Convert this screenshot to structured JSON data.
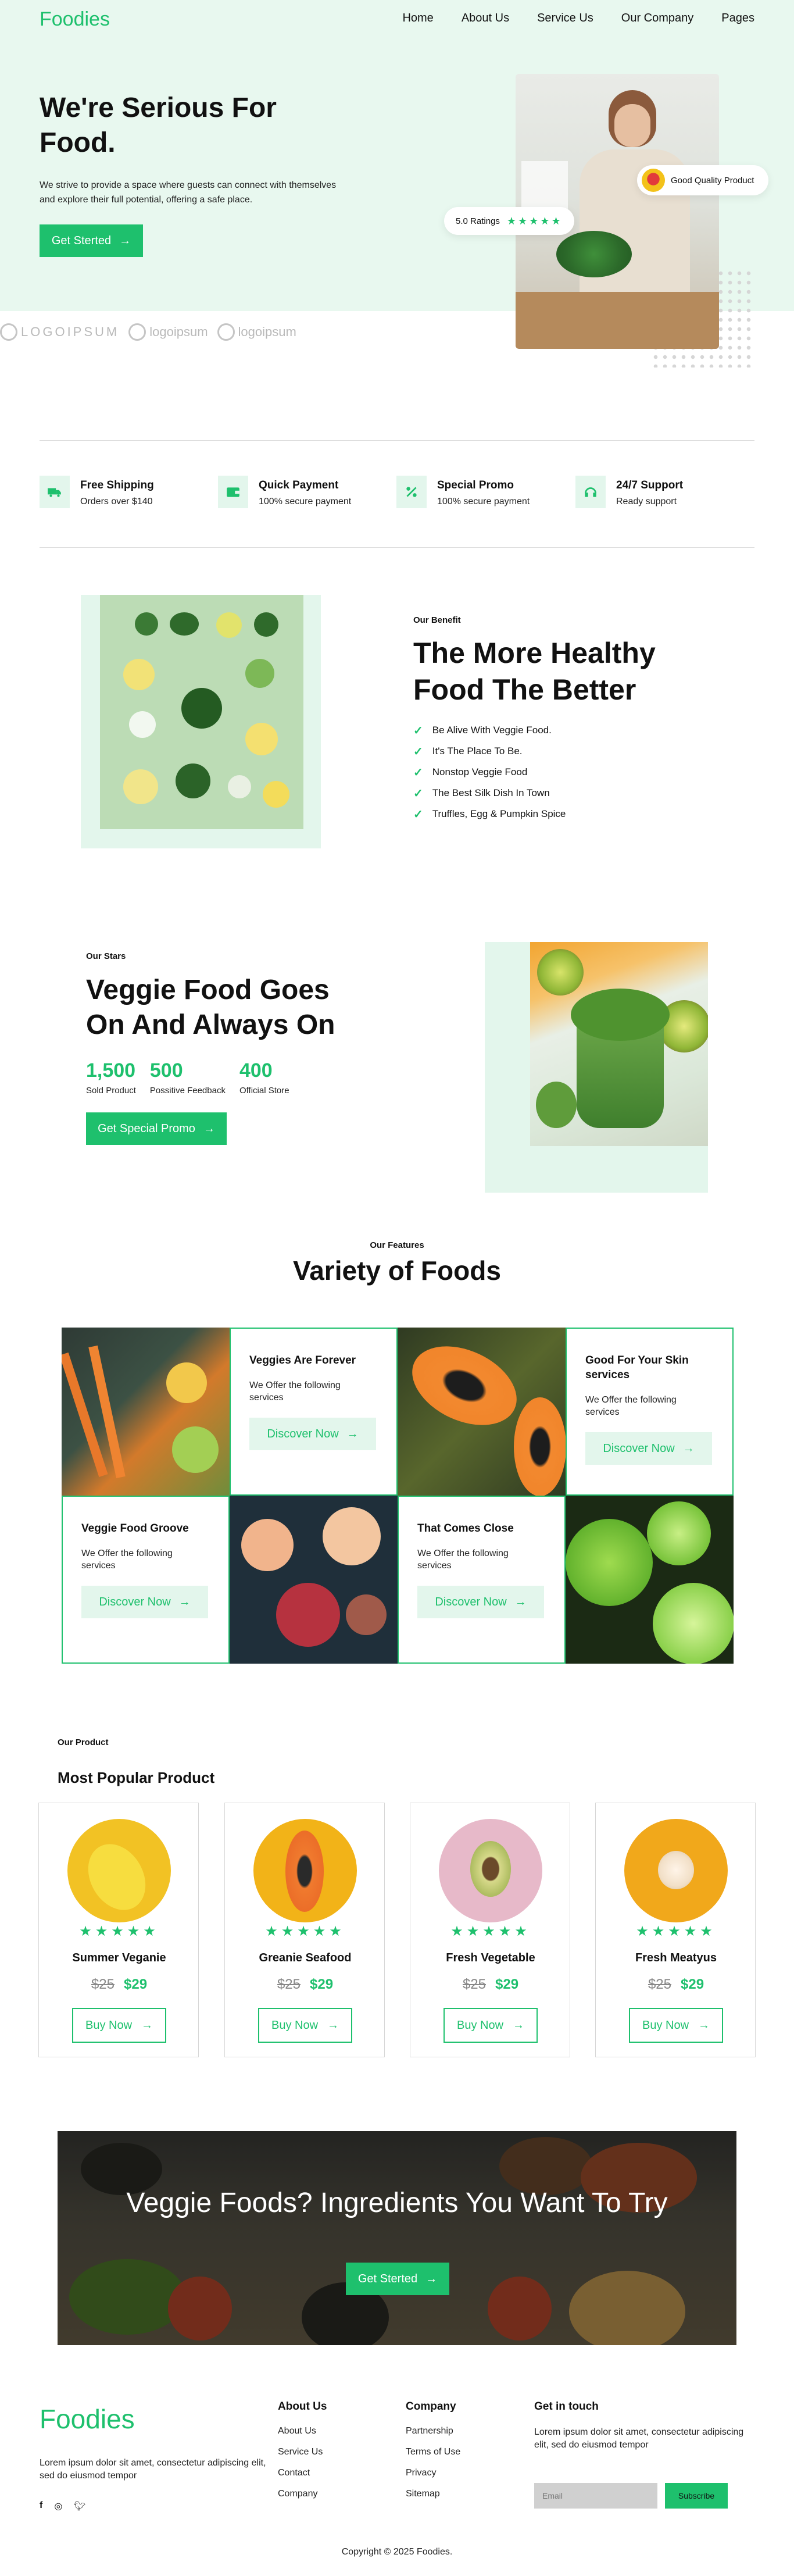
{
  "brand": {
    "name": "Foodies",
    "accent": "#1ec06d",
    "tint": "#e3f6ec"
  },
  "nav": [
    "Home",
    "About Us",
    "Service Us",
    "Our Company",
    "Pages"
  ],
  "hero": {
    "title": "We're Serious For Food.",
    "subtitle": "We strive to provide a space where guests can connect with themselves and explore their full potential, offering a safe place.",
    "cta": "Get Sterted",
    "badge_quality": "Good Quality Product",
    "badge_rating": "5.0 Ratings",
    "partner_logos": [
      "LOGOIPSUM",
      "logoipsum",
      "logoipsum"
    ]
  },
  "features": [
    {
      "icon": "truck-icon",
      "title": "Free Shipping",
      "sub": "Orders over $140"
    },
    {
      "icon": "wallet-icon",
      "title": "Quick Payment",
      "sub": "100% secure payment"
    },
    {
      "icon": "percent-icon",
      "title": "Special Promo",
      "sub": "100% secure payment"
    },
    {
      "icon": "headset-icon",
      "title": "24/7 Support",
      "sub": "Ready support"
    }
  ],
  "benefit": {
    "kicker": "Our Benefit",
    "title": "The More Healthy Food The Better",
    "items": [
      "Be Alive With Veggie Food.",
      "It's The Place To Be.",
      "Nonstop Veggie Food",
      "The Best Silk Dish In Town",
      "Truffles, Egg & Pumpkin Spice"
    ]
  },
  "stars": {
    "kicker": "Our Stars",
    "title": "Veggie Food Goes On And Always On",
    "stats": [
      {
        "value": "1,500",
        "label": "Sold Product"
      },
      {
        "value": "500",
        "label": "Possitive Feedback"
      },
      {
        "value": "400",
        "label": "Official Store"
      }
    ],
    "cta": "Get Special Promo"
  },
  "variety": {
    "kicker": "Our Features",
    "title": "Variety of Foods",
    "cards": [
      {
        "title": "Veggies Are Forever",
        "desc": "We Offer the following services",
        "cta": "Discover Now"
      },
      {
        "title": "Good For Your Skin services",
        "desc": "We Offer the following services",
        "cta": "Discover Now"
      },
      {
        "title": "Veggie Food Groove",
        "desc": "We Offer the following services",
        "cta": "Discover Now"
      },
      {
        "title": "That Comes Close",
        "desc": "We Offer the following services",
        "cta": "Discover Now"
      }
    ]
  },
  "products": {
    "kicker": "Our Product",
    "title": "Most Popular Product",
    "items": [
      {
        "name": "Summer Veganie",
        "old_price": "$25",
        "price": "$29",
        "rating": 5,
        "cta": "Buy Now"
      },
      {
        "name": "Greanie Seafood",
        "old_price": "$25",
        "price": "$29",
        "rating": 5,
        "cta": "Buy Now"
      },
      {
        "name": "Fresh Vegetable",
        "old_price": "$25",
        "price": "$29",
        "rating": 5,
        "cta": "Buy Now"
      },
      {
        "name": "Fresh Meatyus",
        "old_price": "$25",
        "price": "$29",
        "rating": 5,
        "cta": "Buy Now"
      }
    ]
  },
  "cta_banner": {
    "title": "Veggie Foods? Ingredients You Want To Try",
    "cta": "Get Sterted"
  },
  "footer": {
    "logo": "Foodies",
    "about": "Lorem ipsum dolor sit amet, consectetur adipiscing elit, sed do eiusmod tempor",
    "social": [
      "facebook-icon",
      "instagram-icon",
      "twitter-icon"
    ],
    "col1": {
      "title": "About Us",
      "links": [
        "About Us",
        "Service Us",
        "Contact",
        "Company"
      ]
    },
    "col2": {
      "title": "Company",
      "links": [
        "Partnership",
        "Terms of Use",
        "Privacy",
        "Sitemap"
      ]
    },
    "touch": {
      "title": "Get in touch",
      "text": "Lorem ipsum dolor sit amet, consectetur adipiscing elit, sed do eiusmod tempor",
      "email_placeholder": "Email",
      "button": "Subscribe"
    },
    "copyright": "Copyright © 2025 Foodies."
  }
}
